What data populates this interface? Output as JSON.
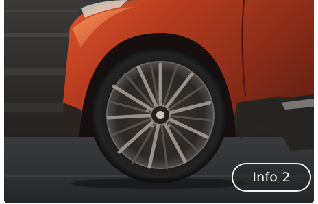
{
  "image": {
    "subject": "car-wheel-photo"
  },
  "info_button": {
    "label": "Info 2"
  },
  "colors": {
    "body_paint": "#a8351c",
    "ground": "#2e3033",
    "button_border": "#f2f2f2",
    "button_text": "#ffffff"
  }
}
